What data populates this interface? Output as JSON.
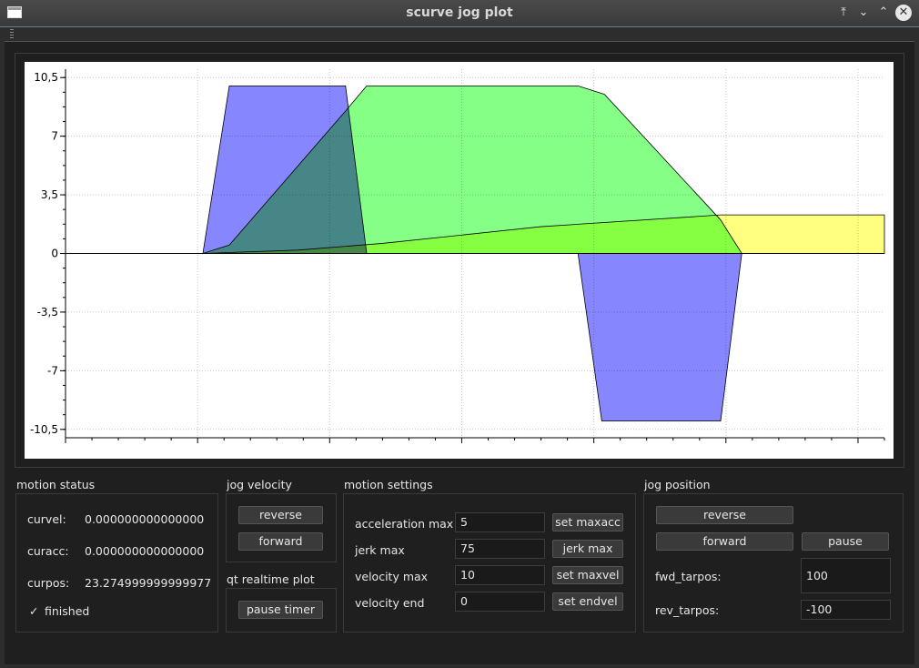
{
  "window": {
    "title": "scurve jog plot"
  },
  "icons": {
    "app": "window-icon",
    "minimize_top": "arrow-up-bar-icon",
    "minimize": "chevron-down-icon",
    "maximize": "chevron-up-icon",
    "close": "close-icon"
  },
  "colors": {
    "accel": "#7f7fff",
    "velocity": "#80ff80",
    "position": "#ffff80",
    "overlap_blue_green": "#4080c0",
    "overlap_green_yellow": "#c0ff40"
  },
  "chart_data": {
    "type": "area",
    "title": "",
    "xlabel": "",
    "ylabel": "",
    "ylim": [
      -11,
      11
    ],
    "yticks": [
      "10,5",
      "7",
      "3,5",
      "0",
      "-3,5",
      "-7",
      "-10,5"
    ],
    "ytick_values": [
      10.5,
      7,
      3.5,
      0,
      -3.5,
      -7,
      -10.5
    ],
    "grid": true,
    "series": [
      {
        "values": [
          [
            0,
            0
          ],
          [
            2.6,
            0
          ],
          [
            3.1,
            10
          ],
          [
            5.3,
            10
          ],
          [
            5.7,
            0
          ],
          [
            9.7,
            0
          ],
          [
            10.15,
            -10
          ],
          [
            12.4,
            -10
          ],
          [
            12.8,
            0
          ],
          [
            15.5,
            0
          ]
        ]
      },
      {
        "values": [
          [
            0,
            0
          ],
          [
            2.6,
            0
          ],
          [
            3.1,
            0.5
          ],
          [
            5.3,
            8.5
          ],
          [
            5.7,
            10
          ],
          [
            9.7,
            10
          ],
          [
            10.2,
            9.5
          ],
          [
            12.4,
            2
          ],
          [
            12.8,
            0
          ],
          [
            15.5,
            0
          ]
        ]
      },
      {
        "values": [
          [
            0,
            0
          ],
          [
            2.6,
            0
          ],
          [
            4.4,
            0.2
          ],
          [
            6.0,
            0.6
          ],
          [
            9.0,
            1.6
          ],
          [
            12.4,
            2.3
          ],
          [
            15.5,
            2.3
          ]
        ]
      }
    ]
  },
  "motion_status": {
    "title": "motion status",
    "curvel_label": "curvel:",
    "curvel_value": "0.000000000000000",
    "curacc_label": "curacc:",
    "curacc_value": "0.000000000000000",
    "curpos_label": "curpos:",
    "curpos_value": "23.274999999999977",
    "finished_mark": "✓",
    "finished_label": "finished"
  },
  "jog_velocity": {
    "title": "jog velocity",
    "reverse": "reverse",
    "forward": "forward"
  },
  "qt_realtime_plot": {
    "title": "qt realtime plot",
    "pause_timer": "pause timer"
  },
  "motion_settings": {
    "title": "motion settings",
    "rows": [
      {
        "label": "acceleration max",
        "value": "5",
        "button": "set maxacc"
      },
      {
        "label": "jerk max",
        "value": "75",
        "button": "jerk max"
      },
      {
        "label": "velocity max",
        "value": "10",
        "button": "set maxvel"
      },
      {
        "label": "velocity end",
        "value": "0",
        "button": "set endvel"
      }
    ]
  },
  "jog_position": {
    "title": "jog position",
    "reverse": "reverse",
    "forward": "forward",
    "pause": "pause",
    "fwd_label": "fwd_tarpos:",
    "fwd_value": "100",
    "rev_label": "rev_tarpos:",
    "rev_value": "-100"
  }
}
